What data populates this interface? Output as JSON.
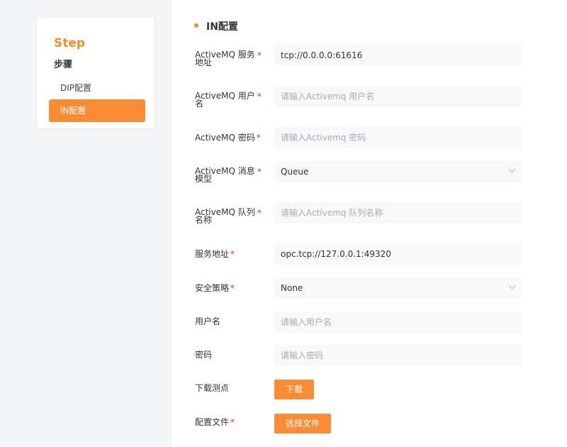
{
  "sidebar": {
    "title": "Step",
    "subtitle": "步骤",
    "items": [
      {
        "label": "DIP配置"
      },
      {
        "label": "IN配置"
      }
    ]
  },
  "form": {
    "section_title": "IN配置",
    "fields": [
      {
        "label_line1": "ActiveMQ 服务",
        "label_line2": "地址",
        "value": "tcp://0.0.0.0:61616",
        "placeholder": ""
      },
      {
        "label_line1": "ActiveMQ 用户",
        "label_line2": "名",
        "value": "",
        "placeholder": "请输入Activemq 用户名"
      },
      {
        "label": "ActiveMQ 密码",
        "value": "",
        "placeholder": "请输入Activemq 密码"
      },
      {
        "label_line1": "ActiveMQ 消息",
        "label_line2": "模型",
        "value": "Queue"
      },
      {
        "label_line1": "ActiveMQ 队列",
        "label_line2": "名称",
        "value": "",
        "placeholder": "请输入Activemq 队列名称"
      },
      {
        "label": "服务地址",
        "value": "opc.tcp://127.0.0.1:49320",
        "placeholder": ""
      },
      {
        "label": "安全策略",
        "value": "None"
      },
      {
        "label": "用户名",
        "value": "",
        "placeholder": "请输入用户名"
      },
      {
        "label": "密码",
        "value": "",
        "placeholder": "请输入密码"
      },
      {
        "label": "下载测点",
        "button": "下载"
      },
      {
        "label": "配置文件",
        "button": "选择文件"
      }
    ],
    "required_mark": "*"
  }
}
